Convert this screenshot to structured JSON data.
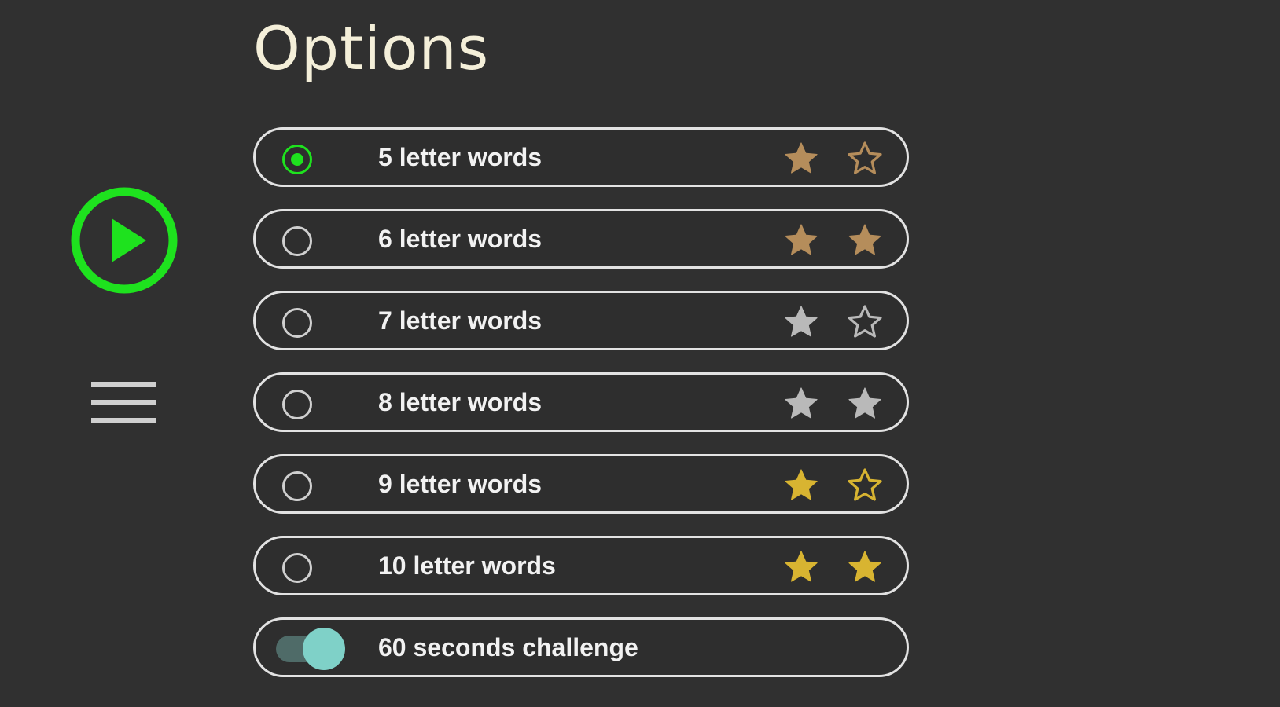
{
  "page": {
    "title": "Options"
  },
  "sidebar": {
    "play_icon": "play-icon",
    "menu_icon": "hamburger-menu-icon"
  },
  "options": [
    {
      "label": "5 letter words",
      "selected": true,
      "stars_filled": 1,
      "star_color": "#b58d5b"
    },
    {
      "label": "6 letter words",
      "selected": false,
      "stars_filled": 2,
      "star_color": "#b58d5b"
    },
    {
      "label": "7 letter words",
      "selected": false,
      "stars_filled": 1,
      "star_color": "#b9b9b9"
    },
    {
      "label": "8 letter words",
      "selected": false,
      "stars_filled": 2,
      "star_color": "#b9b9b9"
    },
    {
      "label": "9 letter words",
      "selected": false,
      "stars_filled": 1,
      "star_color": "#d8b431"
    },
    {
      "label": "10 letter words",
      "selected": false,
      "stars_filled": 2,
      "star_color": "#d8b431"
    }
  ],
  "challenge": {
    "label": "60 seconds challenge",
    "enabled": true
  },
  "colors": {
    "background": "#303030",
    "accent_green": "#1ee21e",
    "toggle_knob": "#7fd1c8",
    "title": "#f4efd9"
  }
}
